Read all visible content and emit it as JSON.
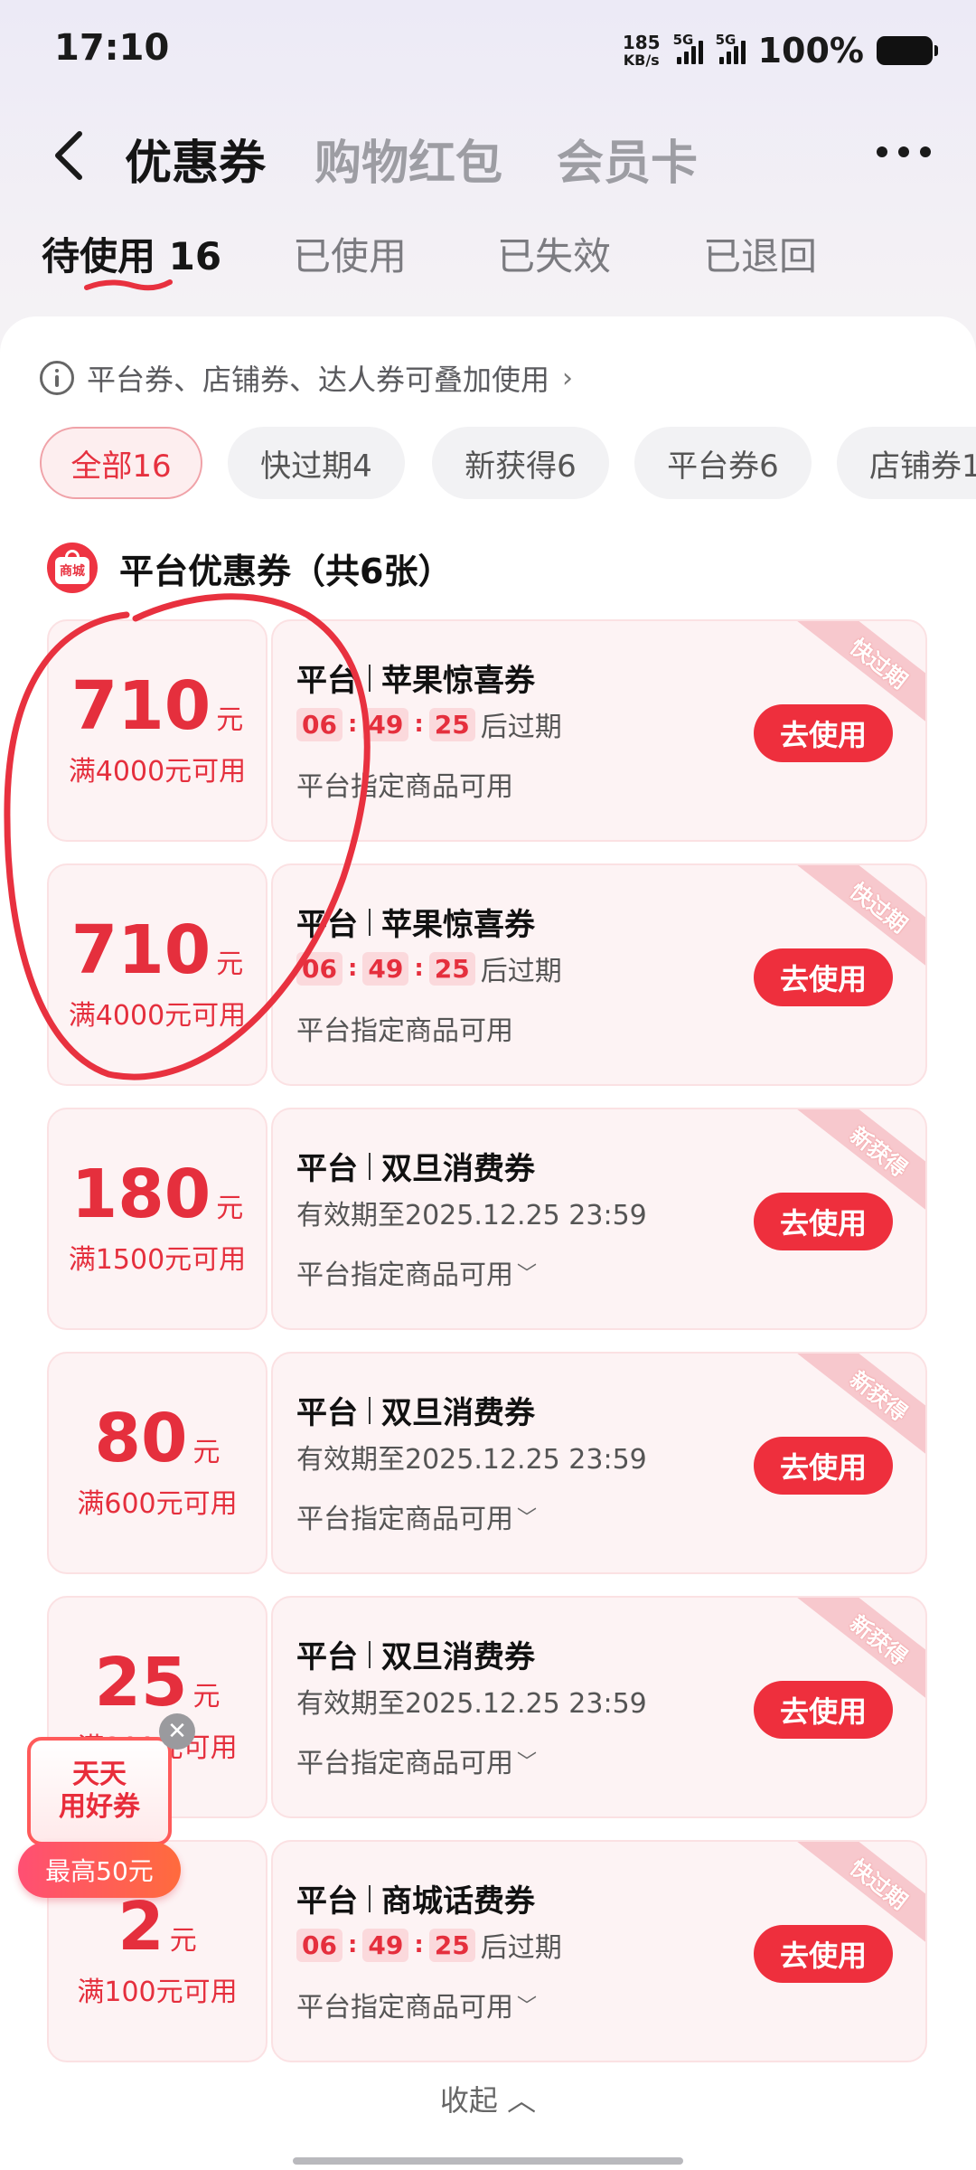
{
  "status_bar": {
    "time": "17:10",
    "net_speed": "185",
    "net_unit": "KB/s",
    "signal1_label": "5G",
    "signal2_label": "5G",
    "battery": "100%"
  },
  "header": {
    "tabs": [
      {
        "label": "优惠券"
      },
      {
        "label": "购物红包"
      },
      {
        "label": "会员卡"
      }
    ]
  },
  "status_tabs": [
    {
      "label": "待使用 16"
    },
    {
      "label": "已使用"
    },
    {
      "label": "已失效"
    },
    {
      "label": "已退回"
    }
  ],
  "notice": "平台券、店铺券、达人券可叠加使用",
  "filters": [
    {
      "label": "全部16"
    },
    {
      "label": "快过期4"
    },
    {
      "label": "新获得6"
    },
    {
      "label": "平台券6"
    },
    {
      "label": "店铺券1"
    }
  ],
  "section": {
    "icon_text": "商城",
    "title": "平台优惠券（共6张）"
  },
  "coupons": [
    {
      "amount": "710",
      "unit": "元",
      "condition": "满4000元可用",
      "source": "平台",
      "name": "苹果惊喜券",
      "countdown": [
        "06",
        "49",
        "25"
      ],
      "expire_suffix": "后过期",
      "scope": "平台指定商品可用",
      "button": "去使用",
      "tag": "快过期"
    },
    {
      "amount": "710",
      "unit": "元",
      "condition": "满4000元可用",
      "source": "平台",
      "name": "苹果惊喜券",
      "countdown": [
        "06",
        "49",
        "25"
      ],
      "expire_suffix": "后过期",
      "scope": "平台指定商品可用",
      "button": "去使用",
      "tag": "快过期"
    },
    {
      "amount": "180",
      "unit": "元",
      "condition": "满1500元可用",
      "source": "平台",
      "name": "双旦消费券",
      "validity": "有效期至2025.12.25 23:59",
      "scope": "平台指定商品可用",
      "button": "去使用",
      "tag": "新获得"
    },
    {
      "amount": "80",
      "unit": "元",
      "condition": "满600元可用",
      "source": "平台",
      "name": "双旦消费券",
      "validity": "有效期至2025.12.25 23:59",
      "scope": "平台指定商品可用",
      "button": "去使用",
      "tag": "新获得"
    },
    {
      "amount": "25",
      "unit": "元",
      "condition": "满200元可用",
      "source": "平台",
      "name": "双旦消费券",
      "validity": "有效期至2025.12.25 23:59",
      "scope": "平台指定商品可用",
      "button": "去使用",
      "tag": "新获得"
    },
    {
      "amount": "2",
      "unit": "元",
      "condition": "满100元可用",
      "source": "平台",
      "name": "商城话费券",
      "countdown": [
        "06",
        "49",
        "25"
      ],
      "expire_suffix": "后过期",
      "scope": "平台指定商品可用",
      "button": "去使用",
      "tag": "快过期"
    }
  ],
  "collapse_label": "收起",
  "float_widget": {
    "line1": "天天",
    "line2": "用好券",
    "badge": "最高50元"
  },
  "colors": {
    "accent": "#ee2f3d",
    "coupon_bg": "#fdf3f4"
  }
}
